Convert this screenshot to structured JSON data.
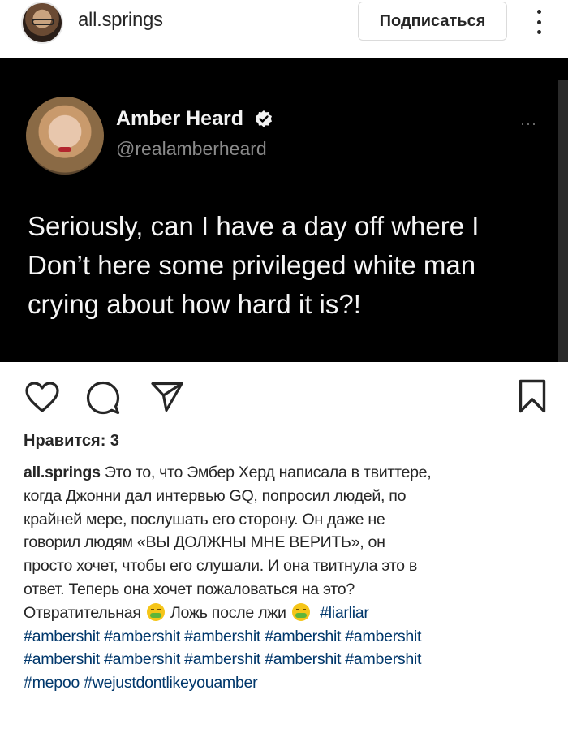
{
  "header": {
    "username": "all.springs",
    "follow_label": "Подписаться"
  },
  "tweet": {
    "name": "Amber Heard",
    "handle": "@realamberheard",
    "more": "···",
    "text_lines": [
      "Seriously, can I have a day off where I",
      "Don’t here some privileged white man",
      "crying about how hard it is?!"
    ]
  },
  "likes": "Нравится: 3",
  "caption": {
    "username": "all.springs",
    "lines": [
      "Это то, что Эмбер Херд написала в твиттере,",
      "когда Джонни дал интервью GQ, попросил людей, по",
      "крайней мере, послушать его сторону. Он даже не",
      "говорил людям «ВЫ ДОЛЖНЫ МНЕ ВЕРИТЬ», он",
      "просто хочет, чтобы его слушали. И она твитнула это в",
      "ответ. Теперь она хочет пожаловаться на это?"
    ],
    "line7_a": "Отвратительная",
    "line7_b": "Ложь после лжи",
    "hashtags": {
      "h1": "#liarliar",
      "row1": "#ambershit #ambershit #ambershit #ambershit #ambershit",
      "row2": "#ambershit #ambershit #ambershit #ambershit #ambershit",
      "h_last1": "#mepoo",
      "h_last2": "#wejustdontlikeyouamber"
    }
  },
  "icons": {
    "like": "heart-icon",
    "comment": "comment-icon",
    "share": "paper-plane-icon",
    "save": "bookmark-icon",
    "more": "more-vertical-icon",
    "verified": "verified-badge-icon"
  },
  "colors": {
    "tweet_bg": "#000000",
    "hashtag": "#00376b",
    "text": "#262626"
  }
}
